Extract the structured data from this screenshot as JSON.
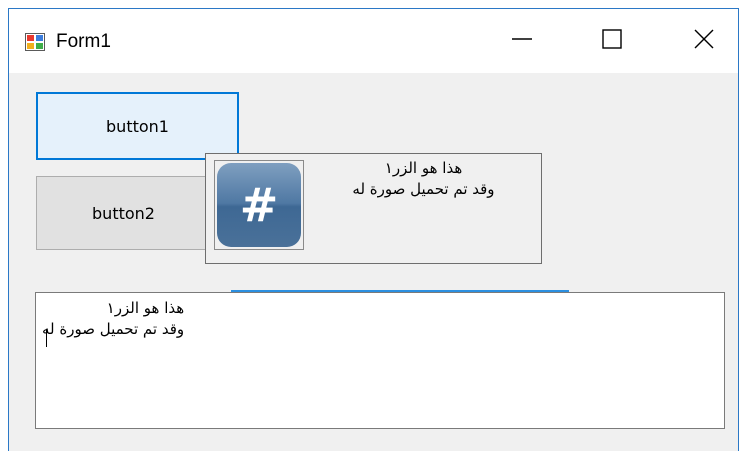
{
  "window": {
    "title": "Form1",
    "controls": {
      "minimize_icon": "minimize-icon",
      "maximize_icon": "maximize-icon",
      "close_icon": "close-icon"
    }
  },
  "buttons": {
    "button1_label": "button1",
    "button2_label": "button2",
    "button3": {
      "line1": "هذا هو الزر١",
      "line2": "وقد تم تحميل صورة له",
      "image_symbol": "#"
    }
  },
  "textbox": {
    "line1": "هذا هو الزر١",
    "line2": "وقد تم تحميل صورة له"
  },
  "colors": {
    "accent": "#0078d7",
    "window_border": "#2b78c6",
    "form_background": "#f0f0f0"
  }
}
